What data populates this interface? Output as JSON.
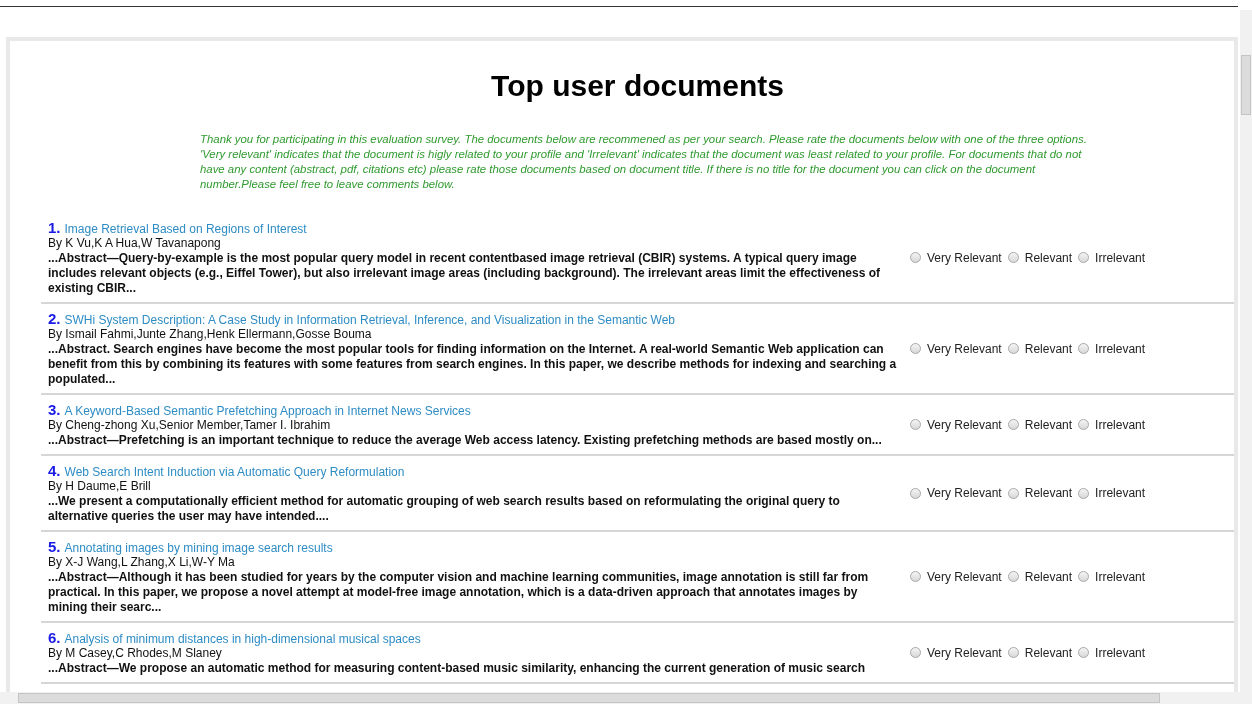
{
  "page": {
    "title": "Top user documents",
    "intro": "Thank you for participating in this evaluation survey. The documents below are recommened as per your search. Please rate the documents below with one of the three options. 'Very relevant' indicates that the document is higly related to your profile and 'Irrelevant' indicates that the document was least related to your profile. For documents that do not have any content (abstract, pdf, citations etc) please rate those documents based on document title. If there is no title for the document you can click on the document number.Please feel free to leave comments below."
  },
  "documents": [
    {
      "number": "1.",
      "title": "Image Retrieval Based on Regions of Interest",
      "authors": "By K Vu,K A Hua,W Tavanapong",
      "abstract": "...Abstract—Query-by-example is the most popular query model in recent contentbased image retrieval (CBIR) systems. A typical query image includes relevant objects (e.g., Eiffel Tower), but also irrelevant image areas (including background). The irrelevant areas limit the effectiveness of existing CBIR...",
      "options": [
        {
          "label": "Very Relevant",
          "selected": false
        },
        {
          "label": "Relevant",
          "selected": false
        },
        {
          "label": "Irrelevant",
          "selected": false
        }
      ]
    },
    {
      "number": "2.",
      "title": "SWHi System Description: A Case Study in Information Retrieval, Inference, and Visualization in the Semantic Web",
      "authors": "By Ismail Fahmi,Junte Zhang,Henk Ellermann,Gosse Bouma",
      "abstract": "...Abstract. Search engines have become the most popular tools for finding information on the Internet. A real-world Semantic Web application can benefit from this by combining its features with some features from search engines. In this paper, we describe methods for indexing and searching a populated...",
      "options": [
        {
          "label": "Very Relevant",
          "selected": false
        },
        {
          "label": "Relevant",
          "selected": false
        },
        {
          "label": "Irrelevant",
          "selected": false
        }
      ]
    },
    {
      "number": "3.",
      "title": "A Keyword-Based Semantic Prefetching Approach in Internet News Services",
      "authors": "By Cheng-zhong Xu,Senior Member,Tamer I. Ibrahim",
      "abstract": "...Abstract—Prefetching is an important technique to reduce the average Web access latency. Existing prefetching methods are based mostly on...",
      "options": [
        {
          "label": "Very Relevant",
          "selected": false
        },
        {
          "label": "Relevant",
          "selected": false
        },
        {
          "label": "Irrelevant",
          "selected": false
        }
      ]
    },
    {
      "number": "4.",
      "title": "Web Search Intent Induction via Automatic Query Reformulation",
      "authors": "By H Daume,E Brill",
      "abstract": "...We present a computationally efficient method for automatic grouping of web search results based on reformulating the original query to alternative queries the user may have intended....",
      "options": [
        {
          "label": "Very Relevant",
          "selected": false
        },
        {
          "label": "Relevant",
          "selected": false
        },
        {
          "label": "Irrelevant",
          "selected": false
        }
      ]
    },
    {
      "number": "5.",
      "title": "Annotating images by mining image search results",
      "authors": "By X-J Wang,L Zhang,X Li,W-Y Ma",
      "abstract": "...Abstract—Although it has been studied for years by the computer vision and machine learning communities, image annotation is still far from practical. In this paper, we propose a novel attempt at model-free image annotation, which is a data-driven approach that annotates images by mining their searc...",
      "options": [
        {
          "label": "Very Relevant",
          "selected": false
        },
        {
          "label": "Relevant",
          "selected": false
        },
        {
          "label": "Irrelevant",
          "selected": false
        }
      ]
    },
    {
      "number": "6.",
      "title": "Analysis of minimum distances in high-dimensional musical spaces",
      "authors": "By M Casey,C Rhodes,M Slaney",
      "abstract": "...Abstract—We propose an automatic method for measuring content-based music similarity, enhancing the current generation of music search",
      "options": [
        {
          "label": "Very Relevant",
          "selected": false
        },
        {
          "label": "Relevant",
          "selected": false
        },
        {
          "label": "Irrelevant",
          "selected": false
        }
      ]
    }
  ]
}
